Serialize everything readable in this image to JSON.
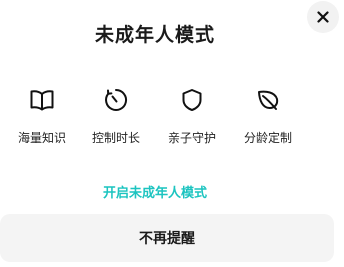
{
  "dialog": {
    "title": "未成年人模式",
    "close_icon": "close-icon"
  },
  "features": [
    {
      "icon": "book-icon",
      "label": "海量知识"
    },
    {
      "icon": "timer-icon",
      "label": "控制时长"
    },
    {
      "icon": "shield-icon",
      "label": "亲子守护"
    },
    {
      "icon": "leaf-icon",
      "label": "分龄定制"
    }
  ],
  "actions": {
    "enable_label": "开启未成年人模式",
    "dismiss_label": "不再提醒"
  },
  "colors": {
    "accent": "#1cc4c0",
    "button_bg": "#f4f4f4",
    "close_bg": "#f2f2f2",
    "text": "#1a1a1a"
  }
}
